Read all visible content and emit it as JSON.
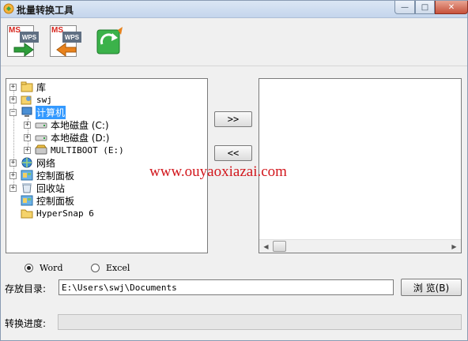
{
  "window": {
    "title": "批量转换工具",
    "controls": {
      "minimize": "—",
      "maximize": "□",
      "close": "✕"
    }
  },
  "toolbar": {
    "buttons": [
      {
        "name": "ms-to-wps",
        "top_text": "MS",
        "badge_text": "WPS",
        "arrow": "right",
        "arrow_color": "#2e9e3a"
      },
      {
        "name": "wps-to-ms",
        "top_text": "MS",
        "badge_text": "WPS",
        "arrow": "left",
        "arrow_color": "#e8821c"
      },
      {
        "name": "refresh",
        "icon": "refresh-icon"
      }
    ]
  },
  "tree": {
    "items": [
      {
        "label": "库",
        "icon": "library-icon",
        "expander": "+"
      },
      {
        "label": "swj",
        "icon": "user-folder-icon",
        "expander": "+"
      },
      {
        "label": "计算机",
        "icon": "computer-icon",
        "expander": "−",
        "selected": true
      },
      {
        "label": "本地磁盘 (C:)",
        "icon": "drive-icon",
        "expander": "+"
      },
      {
        "label": "本地磁盘 (D:)",
        "icon": "drive-icon",
        "expander": "+"
      },
      {
        "label": "MULTIBOOT (E:)",
        "icon": "removable-drive-icon",
        "expander": "+"
      },
      {
        "label": "网络",
        "icon": "network-icon",
        "expander": "+"
      },
      {
        "label": "控制面板",
        "icon": "control-panel-icon",
        "expander": "+"
      },
      {
        "label": "回收站",
        "icon": "recycle-bin-icon",
        "expander": "+"
      },
      {
        "label": "控制面板",
        "icon": "control-panel-icon",
        "expander": ""
      },
      {
        "label": "HyperSnap 6",
        "icon": "folder-icon",
        "expander": ""
      }
    ]
  },
  "transfer": {
    "add_label": ">>",
    "remove_label": "<<"
  },
  "watermark": "www.ouyaoxiazai.com",
  "format": {
    "options": [
      {
        "label": "Word",
        "checked": true
      },
      {
        "label": "Excel",
        "checked": false
      }
    ]
  },
  "save": {
    "label": "存放目录:",
    "value": "E:\\Users\\swj\\Documents",
    "browse_label": "浏 览(B)"
  },
  "progress": {
    "label": "转换进度:",
    "value": 0.0
  }
}
